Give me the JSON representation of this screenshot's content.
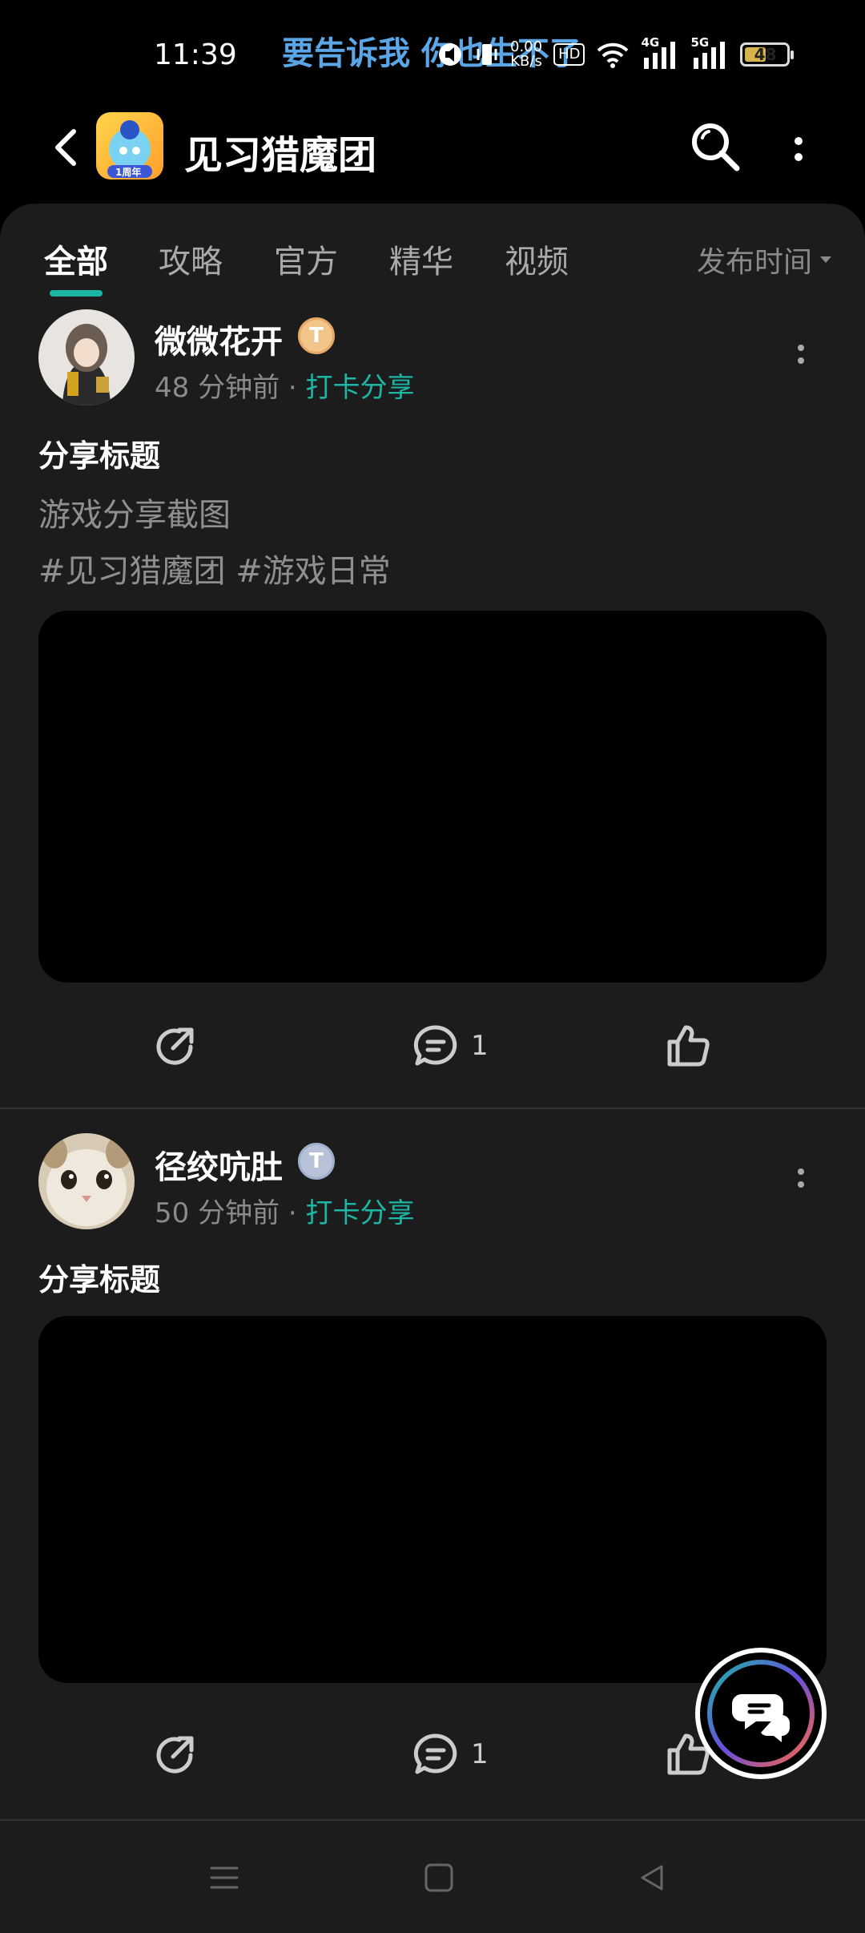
{
  "status_bar": {
    "time": "11:39",
    "lyric": "要告诉我 你也生不了",
    "speed_value": "0.00",
    "speed_unit": "KB/s",
    "hd_label": "HD",
    "network_1": "4G",
    "network_2": "5G",
    "battery_level": "48"
  },
  "header": {
    "title": "见习猎魔团",
    "app_icon_text": "1周年"
  },
  "tabs": [
    {
      "label": "全部",
      "active": true
    },
    {
      "label": "攻略",
      "active": false
    },
    {
      "label": "官方",
      "active": false
    },
    {
      "label": "精华",
      "active": false
    },
    {
      "label": "视频",
      "active": false
    }
  ],
  "sort_label": "发布时间",
  "posts": [
    {
      "username": "微微花开",
      "badge": "T",
      "time": "48 分钟前",
      "separator": " · ",
      "tag": "打卡分享",
      "title": "分享标题",
      "text": "游戏分享截图",
      "hashtags": "#见习猎魔团 #游戏日常",
      "comment_count": "1"
    },
    {
      "username": "径绞吭肚",
      "badge": "T",
      "time": "50 分钟前",
      "separator": " · ",
      "tag": "打卡分享",
      "title": "分享标题",
      "comment_count": "1"
    }
  ],
  "colors": {
    "accent": "#1db5a3",
    "background": "#1c1c1c",
    "lyric": "#5aa6e6"
  }
}
